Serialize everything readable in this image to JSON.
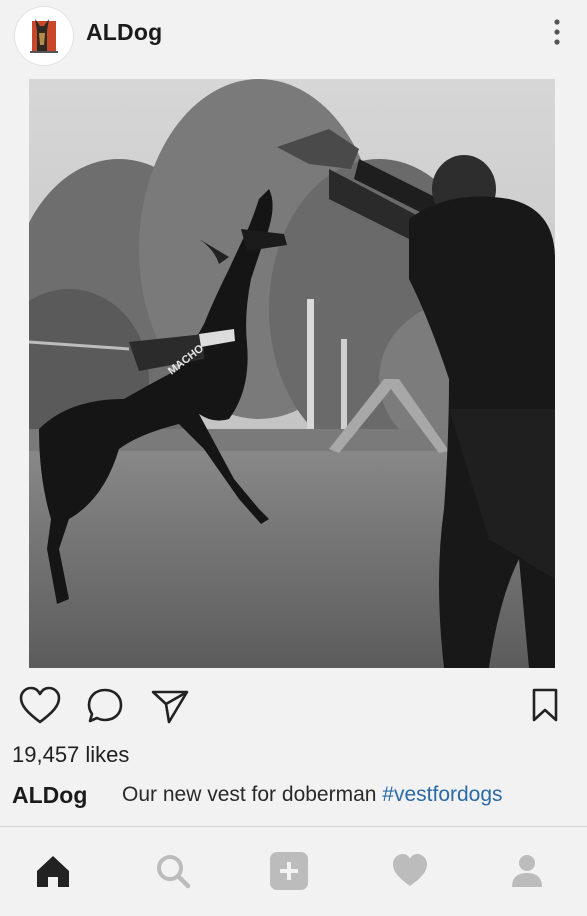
{
  "post": {
    "username": "ALDog",
    "likes": "19,457 likes",
    "caption_user": "ALDog",
    "caption_text": "Our new vest for doberman ",
    "hashtag": "#vestfordogs",
    "harness_text": "MACHO",
    "image_alt": "Black-and-white photo of a doberman in a MACHO harness leaping at a trainer's bite sleeve in a field"
  },
  "icons": {
    "more": "more-vertical-icon",
    "like": "heart-outline-icon",
    "comment": "comment-bubble-icon",
    "share": "paper-plane-icon",
    "save": "bookmark-icon",
    "home": "home-icon",
    "search": "search-icon",
    "add": "add-post-icon",
    "activity": "heart-icon",
    "profile": "profile-icon"
  },
  "colors": {
    "hashtag": "#2a6aa6",
    "active_tab": "#222222",
    "inactive_tab": "#bcbcbc"
  }
}
